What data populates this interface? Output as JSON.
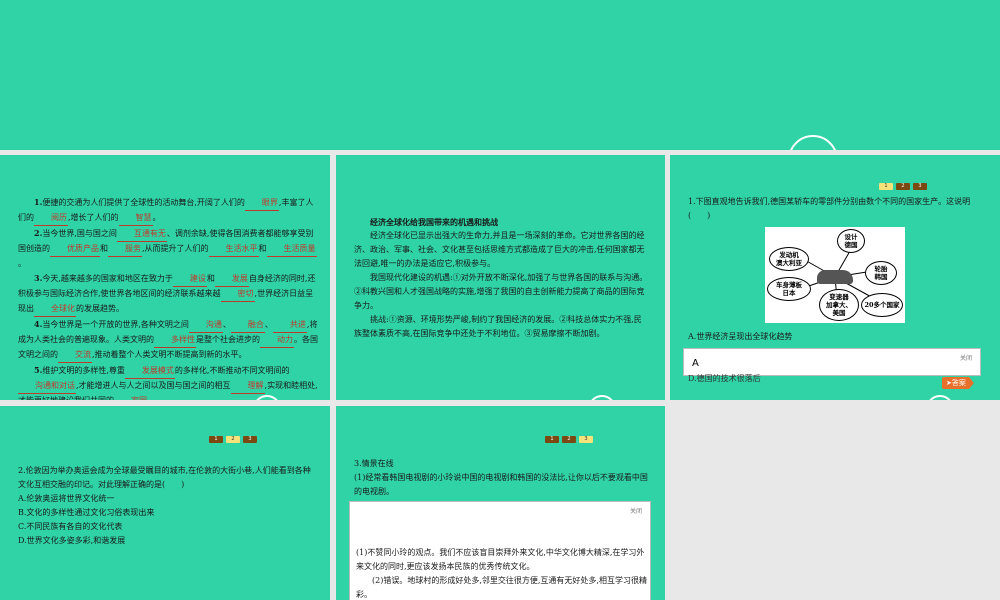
{
  "slide1": {
    "paragraphs": [
      {
        "num": "1.",
        "parts": [
          "便捷的交通为人们提供了全球性的活动舞台,开阔了人们的",
          "眼界",
          ",丰富了人们的",
          "阅历",
          ",增长了人们的",
          "智慧",
          "。"
        ]
      },
      {
        "num": "2.",
        "parts": [
          "当今世界,国与国之间",
          "互通有无",
          "、调剂余缺,使得各国消费者都能够享受别国创造的",
          "优质产品",
          "和",
          "服务",
          ",从而提升了人们的",
          "生活水平",
          "和",
          "生活质量",
          "。"
        ]
      },
      {
        "num": "3.",
        "parts": [
          "今天,越来越多的国家和地区在致力于",
          "建设",
          "和",
          "发展",
          "自身经济的同时,还积极参与国际经济合作,使世界各地区间的经济联系越来越",
          "密切",
          ",世界经济日益呈现出",
          "全球化",
          "的发展趋势。"
        ]
      },
      {
        "num": "4.",
        "parts": [
          "当今世界是一个开放的世界,各种文明之间",
          "沟通",
          "、",
          "融合",
          "、",
          "共进",
          ",将成为人类社会的普遍现象。人类文明的",
          "多样性",
          "是整个社会进步的",
          "动力",
          "。各国文明之间的",
          "交流",
          ",推动着整个人类文明不断提高到新的水平。"
        ]
      },
      {
        "num": "5.",
        "parts": [
          "维护文明的多样性,尊重",
          "发展模式",
          "的多样化,不断推动不同文明间的",
          "沟通和对话",
          ",才能增进人与人之间以及国与国之间的相互",
          "理解",
          ",实现和睦相处,才能更好地建设我们共同的",
          "家园",
          "。"
        ]
      }
    ]
  },
  "slide2": {
    "heading": "经济全球化给我国带来的机遇和挑战",
    "p1": "经济全球化已显示出强大的生命力,并且是一场深刻的革命。它对世界各国的经济、政治、军事、社会、文化甚至包括思维方式都造成了巨大的冲击,任何国家都无法回避,唯一的办法是适应它,积极参与。",
    "p2": "我国现代化建设的机遇:①对外开放不断深化,加强了与世界各国的联系与沟通。②科教兴国和人才强国战略的实施,增强了我国的自主创新能力提高了商品的国际竞争力。",
    "p3": "挑战:①资源、环境形势严峻,制约了我国经济的发展。②科技总体实力不强,民族整体素质不高,在国际竞争中还处于不利地位。③贸易摩擦不断加剧。"
  },
  "slide3": {
    "pager": [
      "1",
      "2",
      "3"
    ],
    "question": "1.下图直观地告诉我们,德国某轿车的零部件分别由数个不同的国家生产。这说明(　　)",
    "diagram_nodes": [
      "设计\n德国",
      "发动机\n澳大利亚",
      "轮胎\n韩国",
      "车身薄板\n日本",
      "变速器\n加拿大、\n美国",
      "20多个国家"
    ],
    "optionA": "A.世界经济呈现出全球化趋势",
    "optionD": "D.德国的技术很落后",
    "popup_close": "关闭",
    "popup_answer": "A",
    "answer_btn": "答案"
  },
  "slide4": {
    "pager": [
      "1",
      "2",
      "3"
    ],
    "question": "2.伦敦因为举办奥运会成为全球最受瞩目的城市,在伦敦的大街小巷,人们能看到各种文化互相交融的印记。对此理解正确的是(　　)",
    "options": [
      "A.伦敦奥运将世界文化统一",
      "B.文化的多样性通过文化习俗表现出来",
      "C.不同民族有各自的文化代表",
      "D.世界文化多姿多彩,和谐发展"
    ]
  },
  "slide5": {
    "pager": [
      "1",
      "2",
      "3"
    ],
    "title": "3.情景在线",
    "q1": "(1)经常看韩国电视剧的小玲说中国的电视剧和韩国的没法比,让你以后不要观看中国的电视剧。",
    "popup_close": "关闭",
    "ans1": "(1)不赞同小玲的观点。我们不应该盲目崇拜外来文化,中华文化博大精深,在学习外来文化的同时,更应该发扬本民族的优秀传统文化。",
    "ans2": "(2)错误。地球村的形成好处多,邻里交往很方便,互通有无好处多,相互学习很精彩。"
  }
}
